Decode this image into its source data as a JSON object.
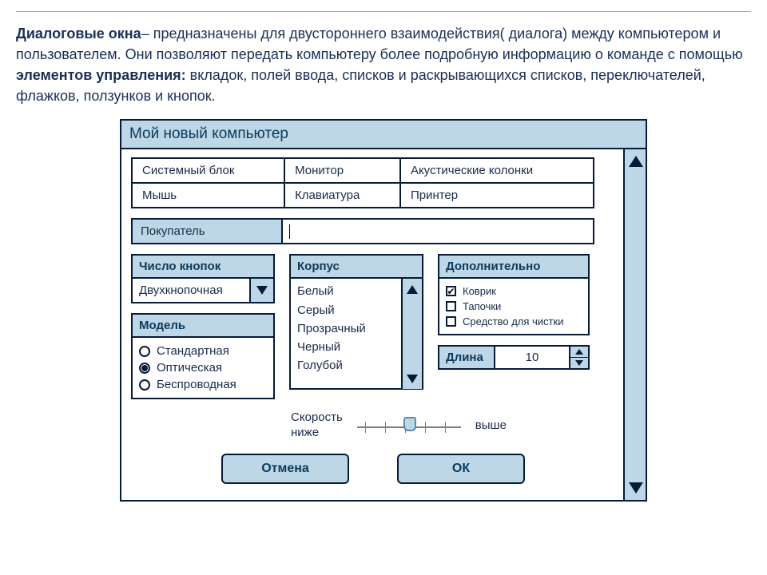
{
  "intro": {
    "bold1": "Диалоговые окна",
    "seg1": "– предназначены для двустороннего взаимодействия( диалога) между компьютером и пользователем.  Они позволяют передать компьютеру более подробную информацию о команде с помощью ",
    "bold2": "элементов управления:",
    "seg2": " вкладок, полей ввода, списков и раскрывающихся списков, переключателей, флажков, ползунков и кнопок."
  },
  "dialog": {
    "title": "Мой новый компьютер",
    "tabs_row1": [
      "Системный блок",
      "Монитор",
      "Акустические колонки"
    ],
    "tabs_row2": [
      "Мышь",
      "Клавиатура",
      "Принтер"
    ],
    "buyer_label": "Покупатель",
    "button_count": {
      "title": "Число кнопок",
      "value": "Двухкнопочная"
    },
    "model": {
      "title": "Модель",
      "options": [
        "Стандартная",
        "Оптическая",
        "Беспроводная"
      ],
      "selected": 1
    },
    "casing": {
      "title": "Корпус",
      "items": [
        "Белый",
        "Серый",
        "Прозрачный",
        "Черный",
        "Голубой"
      ]
    },
    "extras": {
      "title": "Дополнительно",
      "items": [
        {
          "label": "Коврик",
          "checked": true
        },
        {
          "label": "Тапочки",
          "checked": false
        },
        {
          "label": "Средство для чистки",
          "checked": false
        }
      ]
    },
    "length": {
      "label": "Длина",
      "value": "10"
    },
    "speed": {
      "label": "Скорость",
      "low": "ниже",
      "high": "выше"
    },
    "buttons": {
      "cancel": "Отмена",
      "ok": "ОК"
    }
  }
}
